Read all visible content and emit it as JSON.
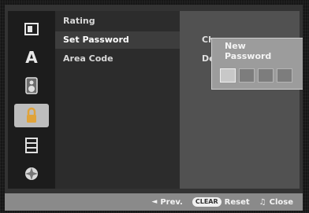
{
  "sidebar": {
    "icons": [
      {
        "name": "general-icon"
      },
      {
        "name": "language-icon",
        "glyph": "A"
      },
      {
        "name": "audio-icon"
      },
      {
        "name": "lock-icon",
        "selected": true
      },
      {
        "name": "recording-icon"
      },
      {
        "name": "disc-icon"
      }
    ]
  },
  "menu": {
    "items": [
      {
        "label": "Rating"
      },
      {
        "label": "Set Password",
        "selected": true
      },
      {
        "label": "Area Code"
      }
    ]
  },
  "detail": {
    "option1": "Change",
    "option2": "De"
  },
  "password_popup": {
    "line1": "New",
    "line2": "Password",
    "digit_count": 4
  },
  "footer": {
    "prev_icon": "◄",
    "prev_label": "Prev.",
    "clear_badge": "CLEAR",
    "reset_label": "Reset",
    "close_icon": "♫",
    "close_label": "Close"
  }
}
